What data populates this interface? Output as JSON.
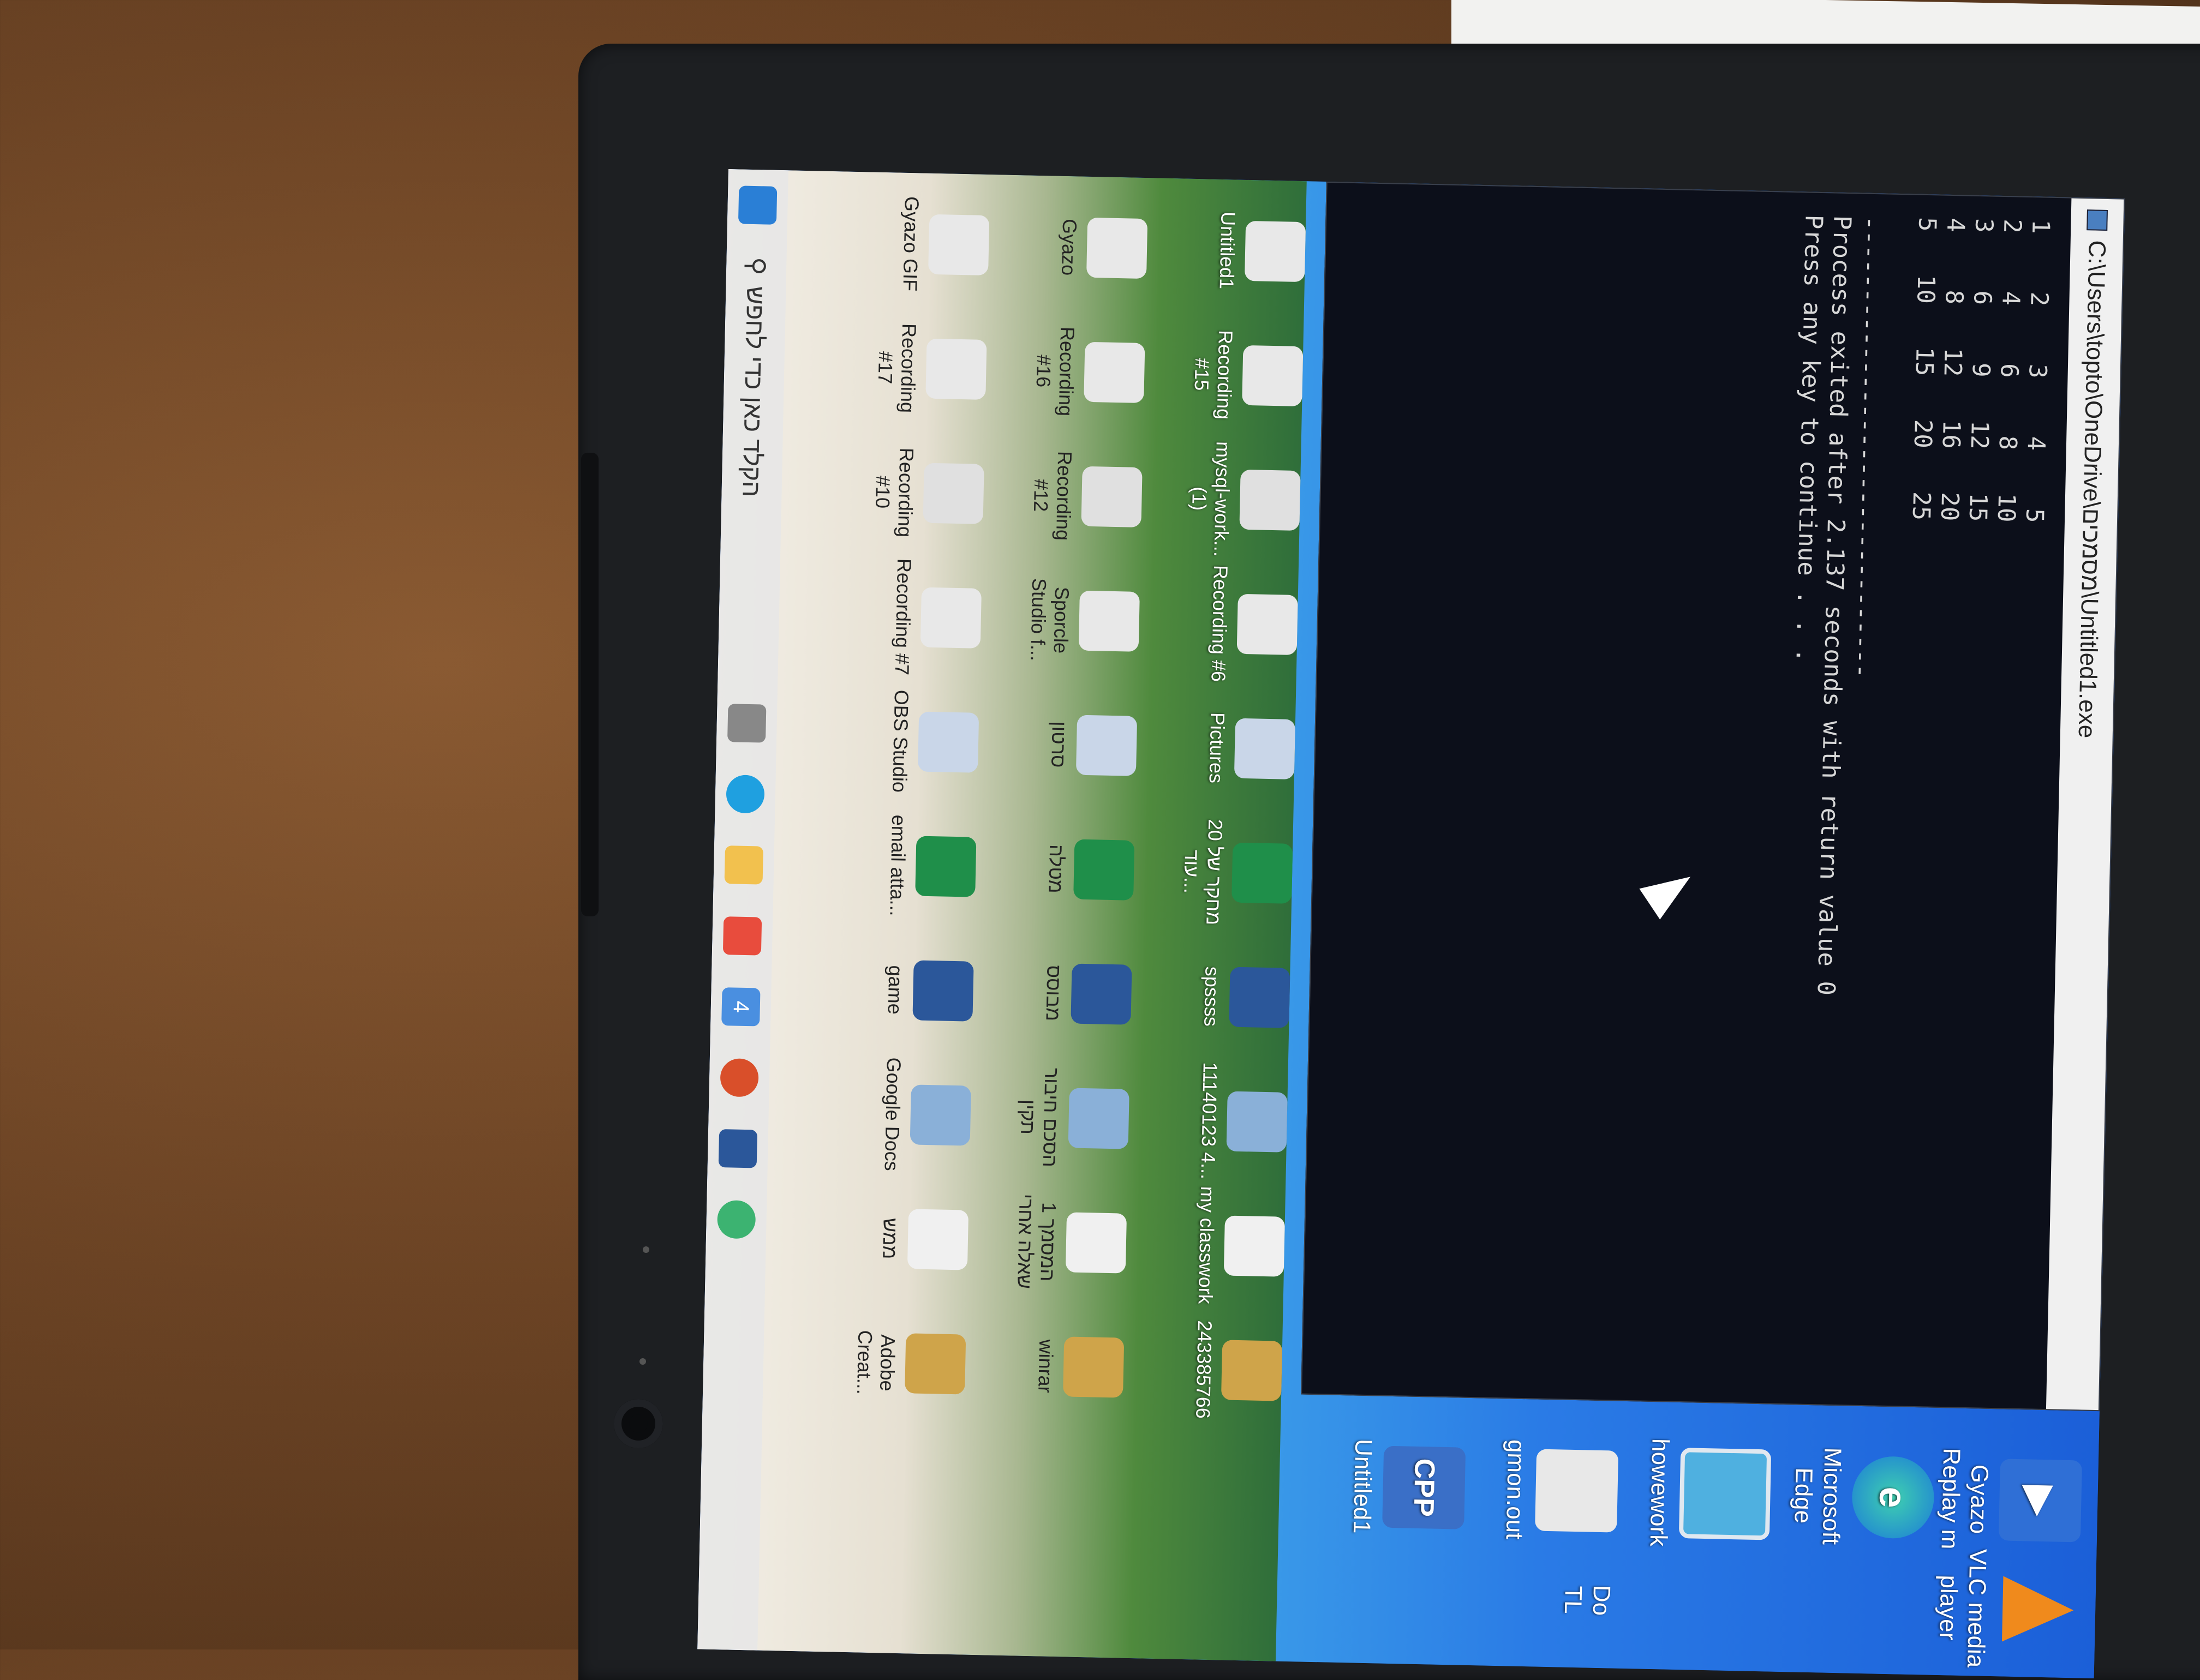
{
  "console": {
    "title": "C:\\Users\\topto\\OneDrive\\מסמכים\\Untitled1.exe",
    "rows": [
      "1    2    3    4    5",
      "2    4    6    8   10",
      "3    6    9   12   15",
      "4    8   12   16   20",
      "5   10   15   20   25"
    ],
    "separator": "--------------------------------",
    "exit_line": "Process exited after 2.137 seconds with return value 0",
    "continue_line": "Press any key to continue . . ."
  },
  "left_icons": [
    {
      "label": "Gyazo Replay m",
      "icon": "gyazo-replay-icon",
      "color": "#2f6fd6"
    },
    {
      "label": "Microsoft Edge",
      "icon": "edge-icon",
      "color": "#1b9bd8"
    },
    {
      "label": "howework",
      "icon": "file-icon",
      "color": "#4fb0e0"
    },
    {
      "label": "gmon.out",
      "icon": "file-icon",
      "color": "#e8e8e8"
    },
    {
      "label": "Untitled1",
      "icon": "cpp-file-icon",
      "color": "#3a6fc7"
    }
  ],
  "left_icons_col2": [
    {
      "label": "VLC media player",
      "icon": "vlc-icon",
      "color": "#f08a1c"
    },
    {
      "label": "Do",
      "icon": "file-icon",
      "color": "#ffffff"
    },
    {
      "label": "TL",
      "icon": "file-icon",
      "color": "#ffffff"
    }
  ],
  "desktop_row1": [
    {
      "label": "Untitled1"
    },
    {
      "label": "Recording #15"
    },
    {
      "label": "mysql-work... (1)"
    },
    {
      "label": "Recording #6"
    },
    {
      "label": "Pictures"
    },
    {
      "label": "מחקר של 20 עוד..."
    },
    {
      "label": "spssss"
    },
    {
      "label": "11140123 4..."
    },
    {
      "label": "my classwork"
    },
    {
      "label": "243385766"
    }
  ],
  "desktop_row2": [
    {
      "label": "Gyazo"
    },
    {
      "label": "Recording #16"
    },
    {
      "label": "Recording #12"
    },
    {
      "label": "Sporcle Studio f..."
    },
    {
      "label": "סרטון"
    },
    {
      "label": "מטלה"
    },
    {
      "label": "מבוסס"
    },
    {
      "label": "הסכם חיבור תקין"
    },
    {
      "label": "המסמך 1 שאלה אחרי"
    },
    {
      "label": "winrar"
    }
  ],
  "desktop_row3": [
    {
      "label": "Gyazo GIF"
    },
    {
      "label": "Recording #17"
    },
    {
      "label": "Recording #10"
    },
    {
      "label": "Recording #7"
    },
    {
      "label": "OBS Studio"
    },
    {
      "label": "email atta..."
    },
    {
      "label": "game"
    },
    {
      "label": "Google Docs"
    },
    {
      "label": "ממש"
    },
    {
      "label": "Adobe Creat..."
    }
  ],
  "taskbar": {
    "search_placeholder": "הקלד כאן כדי לחפש",
    "badge": "4"
  }
}
